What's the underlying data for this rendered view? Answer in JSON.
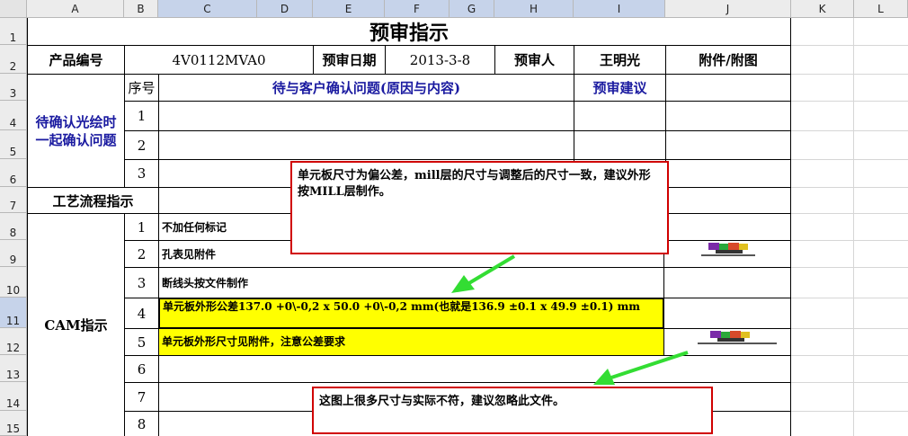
{
  "columns": [
    "A",
    "B",
    "C",
    "D",
    "E",
    "F",
    "G",
    "H",
    "I",
    "J",
    "K",
    "L"
  ],
  "rows": [
    "1",
    "2",
    "3",
    "4",
    "5",
    "6",
    "7",
    "8",
    "9",
    "10",
    "11",
    "12",
    "13",
    "14",
    "15"
  ],
  "title": "预审指示",
  "header": {
    "product_no_label": "产品编号",
    "product_no": "4V0112MVA0",
    "review_date_label": "预审日期",
    "review_date": "2013-3-8",
    "reviewer_label": "预审人",
    "reviewer": "王明光",
    "attachment_label": "附件/附图"
  },
  "confirm": {
    "section_label": "待确认光绘时一起确认问题",
    "seq_label": "序号",
    "issue_label": "待与客户确认问题(原因与内容)",
    "suggest_label": "预审建议",
    "seq": [
      "1",
      "2",
      "3"
    ]
  },
  "process": {
    "label": "工艺流程指示"
  },
  "cam": {
    "label": "CAM指示",
    "seq": [
      "1",
      "2",
      "3",
      "4",
      "5",
      "6",
      "7",
      "8"
    ],
    "items": [
      "不加任何标记",
      "孔表见附件",
      "断线头按文件制作",
      "单元板外形公差137.0 +0\\-0,2  x  50.0 +0\\-0,2 mm(也就是136.9 ±0.1 x 49.9 ±0.1) mm",
      "单元板外形尺寸见附件，注意公差要求"
    ]
  },
  "notes": {
    "note1": "单元板尺寸为偏公差，mill层的尺寸与调整后的尺寸一致，建议外形按MILL层制作。",
    "note2": "这图上很多尺寸与实际不符，建议忽略此文件。"
  },
  "colors": {
    "arrow": "#33dd33",
    "note_border": "#d00000",
    "highlight": "#ffff00"
  }
}
